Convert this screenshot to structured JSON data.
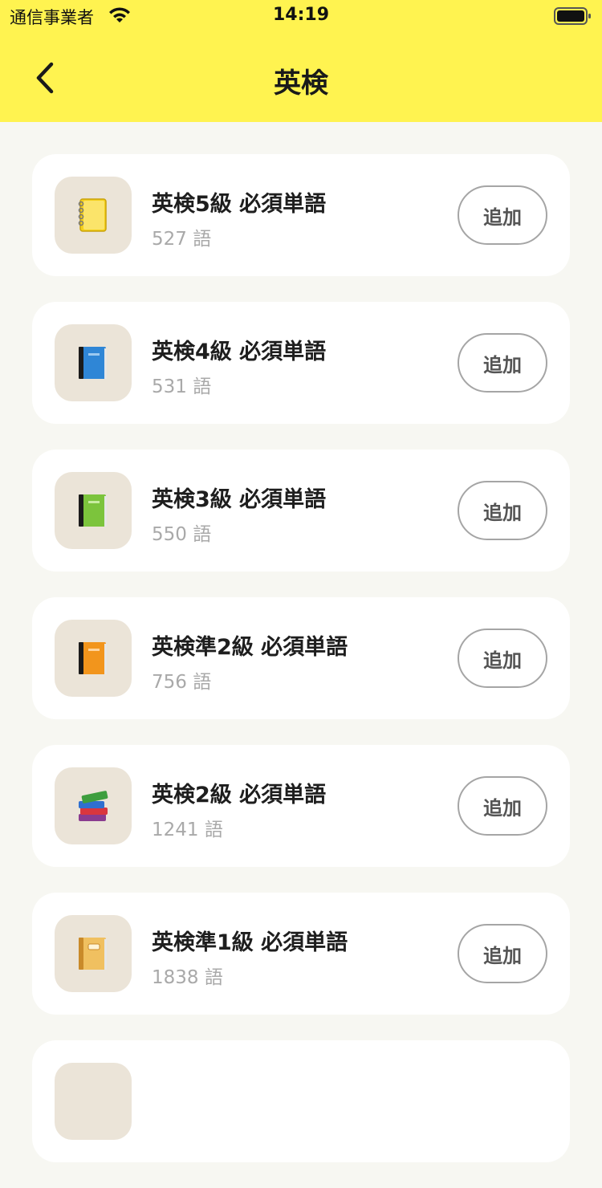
{
  "status_bar": {
    "carrier": "通信事業者",
    "time": "14:19"
  },
  "header": {
    "title": "英検",
    "back_icon": "chevron-left-icon"
  },
  "add_label": "追加",
  "decks": [
    {
      "name": "英検5級 必須単語",
      "count": "527 語",
      "icon": "yellow-notebook-icon",
      "color": "#f4d01c"
    },
    {
      "name": "英検4級 必須単語",
      "count": "531 語",
      "icon": "blue-book-icon",
      "color": "#2f86d6"
    },
    {
      "name": "英検3級 必須単語",
      "count": "550 語",
      "icon": "green-book-icon",
      "color": "#7cc43c"
    },
    {
      "name": "英検準2級 必須単語",
      "count": "756 語",
      "icon": "orange-book-icon",
      "color": "#f2951c"
    },
    {
      "name": "英検2級 必須単語",
      "count": "1241 語",
      "icon": "books-stack-icon",
      "color": "#3e9e3e"
    },
    {
      "name": "英検準1級 必須単語",
      "count": "1838 語",
      "icon": "ledger-icon",
      "color": "#f0c060"
    }
  ]
}
